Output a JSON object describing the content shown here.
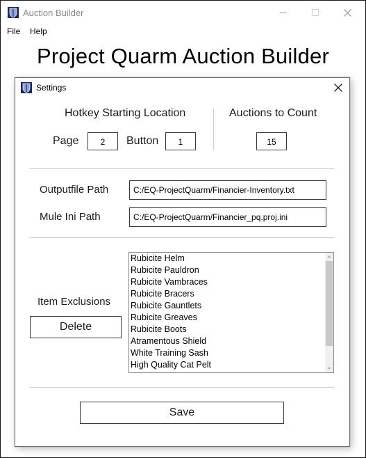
{
  "window": {
    "title": "Auction Builder",
    "icon": "app-shield-icon"
  },
  "menu": {
    "items": [
      {
        "label": "File"
      },
      {
        "label": "Help"
      }
    ]
  },
  "main": {
    "heading": "Project Quarm Auction Builder"
  },
  "settings": {
    "title": "Settings",
    "hotkey": {
      "heading": "Hotkey Starting Location",
      "page_label": "Page",
      "page_value": "2",
      "button_label": "Button",
      "button_value": "1"
    },
    "auctions": {
      "heading": "Auctions to Count",
      "value": "15"
    },
    "paths": {
      "output_label": "Outputfile Path",
      "output_value": "C:/EQ-ProjectQuarm/Financier-Inventory.txt",
      "mule_label": "Mule Ini Path",
      "mule_value": "C:/EQ-ProjectQuarm/Financier_pq.proj.ini"
    },
    "exclusions": {
      "label": "Item Exclusions",
      "delete_label": "Delete",
      "items": [
        "Rubicite Helm",
        "Rubicite Pauldron",
        "Rubicite Vambraces",
        "Rubicite Bracers",
        "Rubicite Gauntlets",
        "Rubicite Greaves",
        "Rubicite Boots",
        "Atramentous Shield",
        "White Training Sash",
        "High Quality Cat Pelt"
      ]
    },
    "save_label": "Save"
  },
  "colors": {
    "title_text": "#8a8a8a",
    "border": "#3a3a3a",
    "separator": "#cfcfcf",
    "scroll_thumb": "#c8c8c8"
  }
}
